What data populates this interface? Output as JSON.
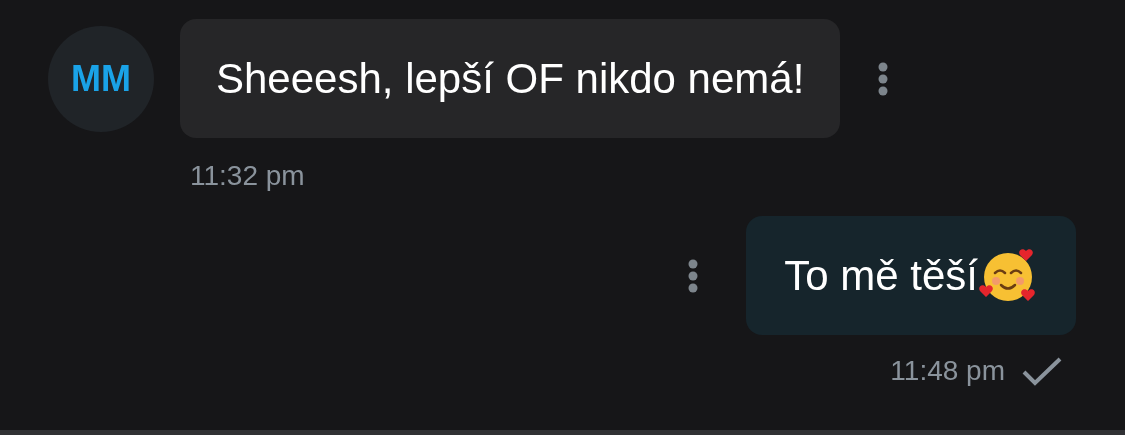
{
  "messages": [
    {
      "kind": "incoming",
      "avatar": "MM",
      "text": "Sheeesh, lepší OF nikdo nemá!",
      "emoji": false,
      "time": "11:32 pm"
    },
    {
      "kind": "outgoing",
      "text": "To mě těší",
      "emoji": true,
      "time": "11:48 pm",
      "read": false
    }
  ]
}
